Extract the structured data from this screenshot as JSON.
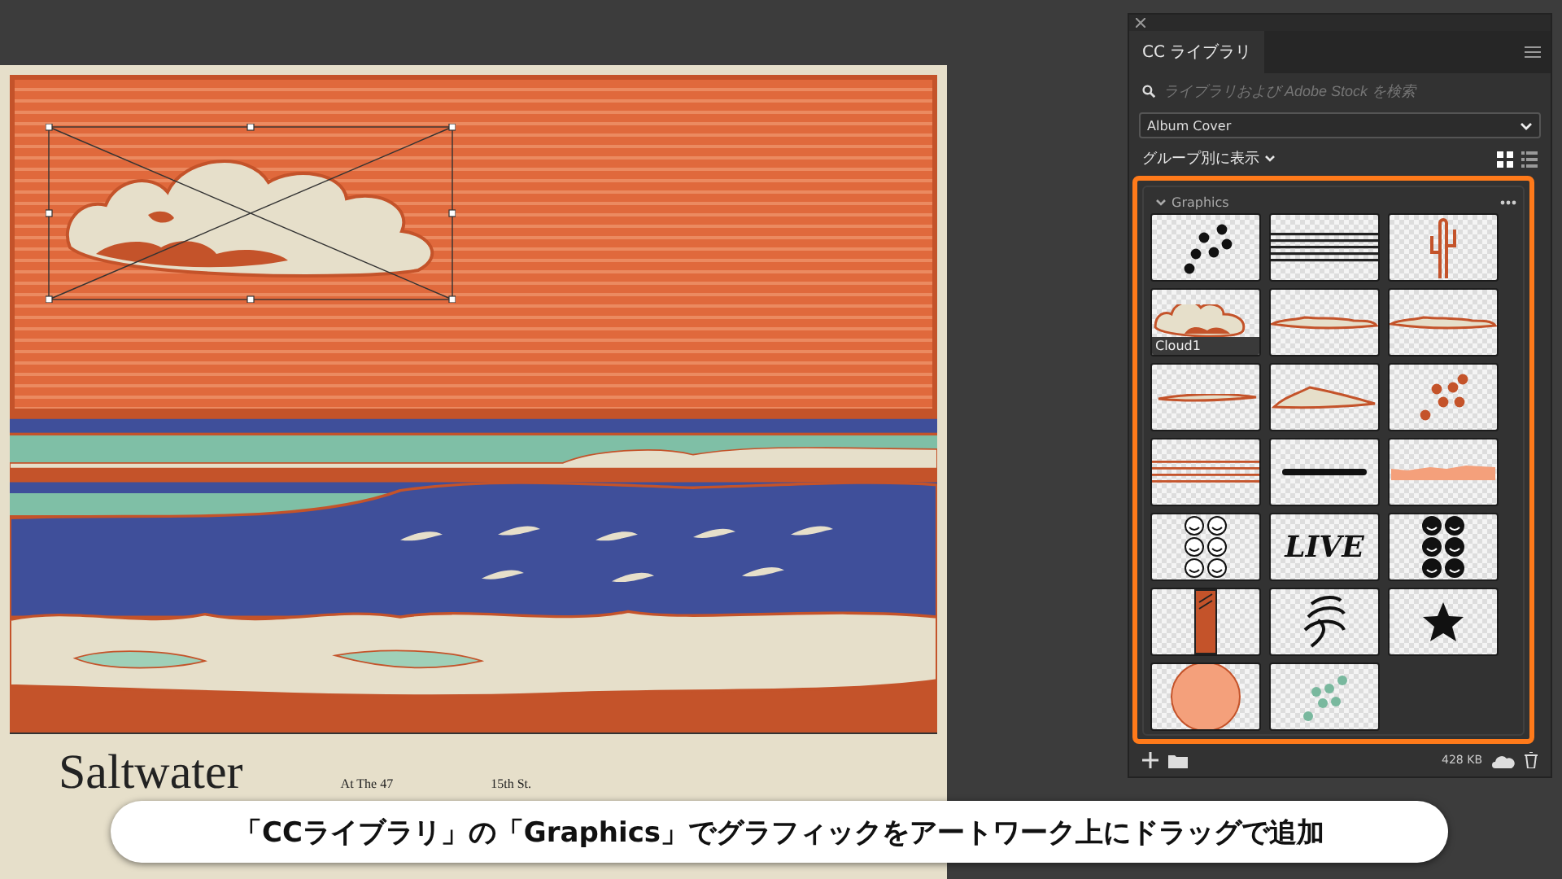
{
  "artboard": {
    "poster_texts": [
      "Saltwater",
      "At The 47",
      "15th St."
    ]
  },
  "panel": {
    "tab": "CC ライブラリ",
    "search": {
      "placeholder": "ライブラリおよび Adobe Stock を検索"
    },
    "library": "Album Cover",
    "group_view": "グループ別に表示",
    "view_grid_selected": true,
    "group": {
      "title": "Graphics",
      "expanded": true,
      "items": [
        {
          "kind": "dots-black"
        },
        {
          "kind": "lines-black"
        },
        {
          "kind": "cactus"
        },
        {
          "kind": "cloud",
          "label": "Cloud1"
        },
        {
          "kind": "cloud-flat"
        },
        {
          "kind": "cloud-flat"
        },
        {
          "kind": "cloud-thin"
        },
        {
          "kind": "cloud-low"
        },
        {
          "kind": "dots-orange"
        },
        {
          "kind": "lines-orange"
        },
        {
          "kind": "bar"
        },
        {
          "kind": "land-strip"
        },
        {
          "kind": "smileys-outline"
        },
        {
          "kind": "text",
          "text": "LIVE"
        },
        {
          "kind": "smileys-filled"
        },
        {
          "kind": "tall-rect"
        },
        {
          "kind": "squiggle"
        },
        {
          "kind": "star"
        },
        {
          "kind": "circle"
        },
        {
          "kind": "dots-green"
        }
      ]
    },
    "storage": "428 KB"
  },
  "caption": "「CCライブラリ」の「Graphics」でグラフィックをアートワーク上にドラッグで追加"
}
